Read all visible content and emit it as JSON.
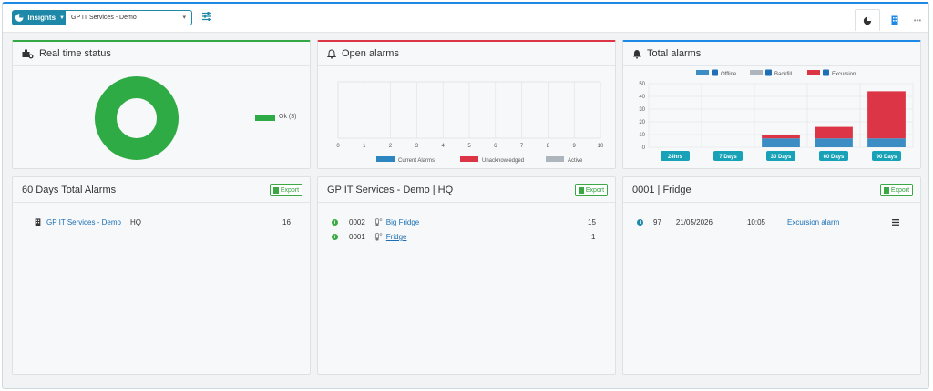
{
  "topbar": {
    "insights_label": "Insights",
    "site_selected": "GP IT Services - Demo"
  },
  "realtime": {
    "title": "Real time status",
    "legend_label": "Ok (3)",
    "ok_color": "#2fab45"
  },
  "open_alarms": {
    "title": "Open alarms",
    "legend": [
      "Current Alarms",
      "Unacknowledged",
      "Active"
    ]
  },
  "total_alarms": {
    "title": "Total alarms",
    "legend": [
      "Offline",
      "Backfill",
      "Excursion"
    ]
  },
  "chart_data": [
    {
      "type": "bar",
      "title": "",
      "categories": [],
      "x": [
        0,
        1,
        2,
        3,
        4,
        5,
        6,
        7,
        8,
        9,
        10
      ],
      "xlim": [
        0,
        10
      ],
      "series": [
        {
          "name": "Current Alarms",
          "values": []
        },
        {
          "name": "Unacknowledged",
          "values": []
        },
        {
          "name": "Active",
          "values": []
        }
      ],
      "colors": [
        "#2e86c1",
        "#dc3545",
        "#adb5bd"
      ],
      "grid": true,
      "legend": "bottom"
    },
    {
      "type": "bar",
      "stacked": true,
      "categories": [
        "24hrs",
        "7 Days",
        "30 Days",
        "60 Days",
        "90 Days"
      ],
      "yticks": [
        0,
        10,
        20,
        30,
        40,
        50
      ],
      "ylim": [
        0,
        50
      ],
      "series": [
        {
          "name": "Offline",
          "values": [
            0,
            0,
            7,
            7,
            7
          ],
          "color": "#3b8dc4"
        },
        {
          "name": "Backfill",
          "values": [
            0,
            0,
            0,
            0,
            0
          ],
          "color": "#adb5bd"
        },
        {
          "name": "Excursion",
          "values": [
            0,
            0,
            3,
            9,
            37
          ],
          "color": "#dc3545"
        }
      ],
      "grid": true,
      "legend": "top"
    }
  ],
  "sixty_days": {
    "title": "60 Days Total Alarms",
    "export_label": "Export",
    "row": {
      "site": "GP IT Services - Demo",
      "location": "HQ",
      "count": "16"
    }
  },
  "hq": {
    "title": "GP IT Services - Demo | HQ",
    "export_label": "Export",
    "rows": [
      {
        "id": "0002",
        "name": "Big Fridge",
        "count": "15"
      },
      {
        "id": "0001",
        "name": "Fridge",
        "count": "1"
      }
    ]
  },
  "fridge": {
    "title": "0001 | Fridge",
    "export_label": "Export",
    "row": {
      "id": "97",
      "date": "21/05/2026",
      "time": "10:05",
      "type": "Excursion alarm"
    }
  }
}
